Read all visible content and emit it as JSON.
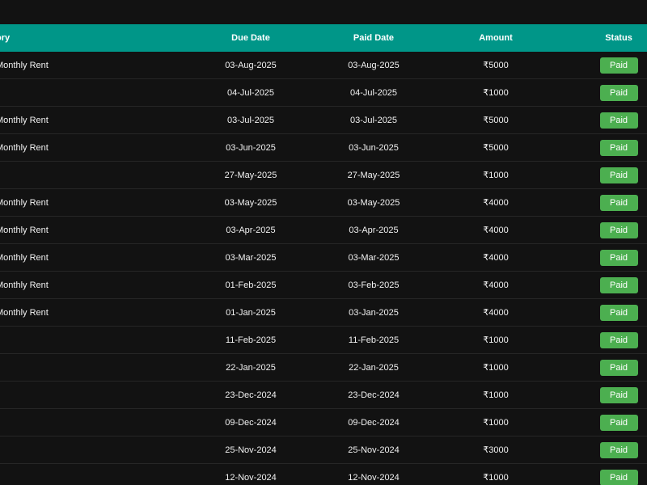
{
  "header": {
    "category": "ory",
    "due_date": "Due Date",
    "paid_date": "Paid Date",
    "amount": "Amount",
    "status": "Status"
  },
  "rows": [
    {
      "category": "Monthly Rent",
      "due": "03-Aug-2025",
      "paid": "03-Aug-2025",
      "amount": "₹5000",
      "status": "Paid"
    },
    {
      "category": "",
      "due": "04-Jul-2025",
      "paid": "04-Jul-2025",
      "amount": "₹1000",
      "status": "Paid"
    },
    {
      "category": "Monthly Rent",
      "due": "03-Jul-2025",
      "paid": "03-Jul-2025",
      "amount": "₹5000",
      "status": "Paid"
    },
    {
      "category": "Monthly Rent",
      "due": "03-Jun-2025",
      "paid": "03-Jun-2025",
      "amount": "₹5000",
      "status": "Paid"
    },
    {
      "category": "",
      "due": "27-May-2025",
      "paid": "27-May-2025",
      "amount": "₹1000",
      "status": "Paid"
    },
    {
      "category": "Monthly Rent",
      "due": "03-May-2025",
      "paid": "03-May-2025",
      "amount": "₹4000",
      "status": "Paid"
    },
    {
      "category": "Monthly Rent",
      "due": "03-Apr-2025",
      "paid": "03-Apr-2025",
      "amount": "₹4000",
      "status": "Paid"
    },
    {
      "category": "Monthly Rent",
      "due": "03-Mar-2025",
      "paid": "03-Mar-2025",
      "amount": "₹4000",
      "status": "Paid"
    },
    {
      "category": "Monthly Rent",
      "due": "01-Feb-2025",
      "paid": "03-Feb-2025",
      "amount": "₹4000",
      "status": "Paid"
    },
    {
      "category": "Monthly Rent",
      "due": "01-Jan-2025",
      "paid": "03-Jan-2025",
      "amount": "₹4000",
      "status": "Paid"
    },
    {
      "category": "",
      "due": "11-Feb-2025",
      "paid": "11-Feb-2025",
      "amount": "₹1000",
      "status": "Paid"
    },
    {
      "category": "",
      "due": "22-Jan-2025",
      "paid": "22-Jan-2025",
      "amount": "₹1000",
      "status": "Paid"
    },
    {
      "category": "",
      "due": "23-Dec-2024",
      "paid": "23-Dec-2024",
      "amount": "₹1000",
      "status": "Paid"
    },
    {
      "category": "",
      "due": "09-Dec-2024",
      "paid": "09-Dec-2024",
      "amount": "₹1000",
      "status": "Paid"
    },
    {
      "category": "",
      "due": "25-Nov-2024",
      "paid": "25-Nov-2024",
      "amount": "₹3000",
      "status": "Paid"
    },
    {
      "category": "",
      "due": "12-Nov-2024",
      "paid": "12-Nov-2024",
      "amount": "₹1000",
      "status": "Paid"
    }
  ],
  "colors": {
    "background": "#121212",
    "header": "#009688",
    "status_paid": "#4caf50",
    "row_divider": "#262626"
  }
}
